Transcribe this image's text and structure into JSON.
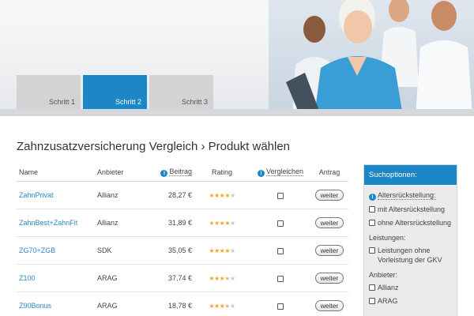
{
  "steps": [
    {
      "label": "Schritt 1",
      "active": false
    },
    {
      "label": "Schritt 2",
      "active": true
    },
    {
      "label": "Schritt 3",
      "active": false
    }
  ],
  "page": {
    "title": "Zahnzusatzversicherung Vergleich › Produkt wählen"
  },
  "table": {
    "headers": {
      "name": "Name",
      "provider": "Anbieter",
      "price": "Beitrag",
      "rating": "Rating",
      "compare": "Vergleichen",
      "action": "Antrag"
    },
    "rows": [
      {
        "name": "ZahnPrivat",
        "provider": "Allianz",
        "price": "28,27 €",
        "rating": 4,
        "action": "weiter"
      },
      {
        "name": "ZahnBest+ZahnFit",
        "provider": "Allianz",
        "price": "31,89 €",
        "rating": 4,
        "action": "weiter"
      },
      {
        "name": "ZG70+ZGB",
        "provider": "SDK",
        "price": "35,05 €",
        "rating": 4,
        "action": "weiter"
      },
      {
        "name": "Z100",
        "provider": "ARAG",
        "price": "37,74 €",
        "rating": 3.5,
        "action": "weiter"
      },
      {
        "name": "Z90Bonus",
        "provider": "ARAG",
        "price": "18,78 €",
        "rating": 3.5,
        "action": "weiter"
      }
    ]
  },
  "sidebar": {
    "title": "Suchoptionen:",
    "age_label": "Altersrückstellung:",
    "age_options": [
      "mit Altersrückstellung",
      "ohne Altersrückstellung"
    ],
    "services_label": "Leistungen:",
    "services_options": [
      "Leistungen ohne Vorleistung der GKV"
    ],
    "providers_label": "Anbieter:",
    "providers_options": [
      "Allianz",
      "ARAG"
    ]
  },
  "colors": {
    "accent": "#1d86c4",
    "link": "#2a88c6",
    "star": "#f0a62a"
  }
}
